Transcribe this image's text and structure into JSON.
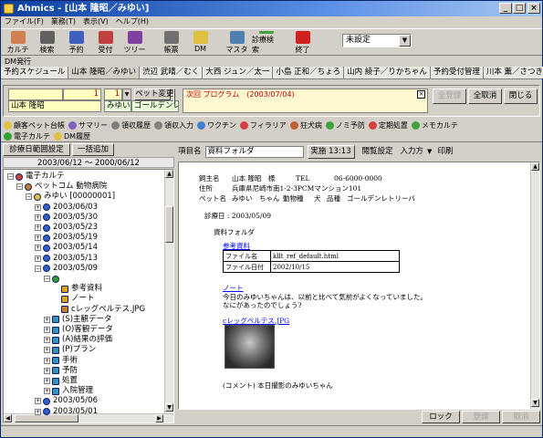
{
  "window": {
    "title": "Ahmics - [山本 隆昭／みゆい]"
  },
  "menu": [
    "ファイル(F)",
    "業務(T)",
    "表示(V)",
    "ヘルプ(H)"
  ],
  "toolbar": {
    "buttons": [
      {
        "label": "カルテ",
        "icon": "skull-icon",
        "color": "#d08050"
      },
      {
        "label": "検索",
        "icon": "binoculars-icon",
        "color": "#606060"
      },
      {
        "label": "予約",
        "icon": "calendar-icon",
        "color": "#4060c0"
      },
      {
        "label": "受付",
        "icon": "checklist-icon",
        "color": "#c04040"
      },
      {
        "label": "ツリー",
        "icon": "tree-icon",
        "color": "#8040a0"
      },
      {
        "label": "帳票",
        "icon": "printer-icon",
        "color": "#707070"
      },
      {
        "label": "DM",
        "icon": "envelope-icon",
        "color": "#e0c040"
      },
      {
        "label": "マスタ",
        "icon": "master-icon",
        "color": "#5080b0"
      },
      {
        "label": "診療検索",
        "icon": "magnifier-icon",
        "color": "#40a040"
      },
      {
        "label": "終了",
        "icon": "stop-icon",
        "color": "#d02020"
      }
    ],
    "select_value": "未設定"
  },
  "dm_label": "DM発行",
  "open_tabs": [
    "予約スケジュール",
    "山本 隆昭／みゆい",
    "渋辺 武晴／むく",
    "大西 ジュン／太一",
    "小島 正和／ちょろ",
    "山内 綾子／りかちゃん",
    "予約受付管理",
    "川本 薫／さつき"
  ],
  "patient": {
    "owner_name": "山本 隆昭",
    "owner_num": "1",
    "pet_name": "みゆい",
    "pet_num": "1",
    "breed": "ゴールデンレトリーバ (♀)",
    "pet_change": "ペット変更",
    "new": "新 規",
    "memo": "次回 プログラム　(2003/07/04)",
    "btn_register": "全登録",
    "btn_cancel_all": "全取消",
    "btn_close": "閉じる"
  },
  "func_tabs_row1": [
    {
      "label": "顧客ペット台帳",
      "color": "#e0c040"
    },
    {
      "label": "サマリー",
      "color": "#8060c0"
    },
    {
      "label": "領収履歴",
      "color": "#808080"
    },
    {
      "label": "領収入力",
      "color": "#808080"
    },
    {
      "label": "ワクチン",
      "color": "#4080d0"
    },
    {
      "label": "フィラリア",
      "color": "#d04040"
    },
    {
      "label": "狂犬病",
      "color": "#c06030"
    },
    {
      "label": "ノミ予防",
      "color": "#40a040"
    },
    {
      "label": "定期処置",
      "color": "#d04040"
    },
    {
      "label": "メモカルテ",
      "color": "#40a040"
    }
  ],
  "func_tabs_row2": [
    {
      "label": "電子カルテ",
      "color": "#30a030"
    },
    {
      "label": "DM履歴",
      "color": "#e0c040"
    }
  ],
  "left": {
    "btn_range": "診療日範囲設定",
    "btn_add": "一括追加",
    "date_range": "2003/06/12 〜 2000/06/12",
    "tree": [
      {
        "label": "電子カルテ",
        "level": 0,
        "type": "root"
      },
      {
        "label": "ペットコム 動物病院",
        "level": 1,
        "type": "hosp"
      },
      {
        "label": "みゆい [00000001]",
        "level": 2,
        "type": "pet"
      },
      {
        "label": "2003/06/03",
        "level": 3,
        "type": "date"
      },
      {
        "label": "2003/05/30",
        "level": 3,
        "type": "date"
      },
      {
        "label": "2003/05/23",
        "level": 3,
        "type": "date"
      },
      {
        "label": "2003/05/19",
        "level": 3,
        "type": "date"
      },
      {
        "label": "2003/05/14",
        "level": 3,
        "type": "date"
      },
      {
        "label": "2003/05/13",
        "level": 3,
        "type": "date"
      },
      {
        "label": "2003/05/09",
        "level": 3,
        "type": "date-open"
      },
      {
        "label": "資料フォルダ",
        "level": 4,
        "type": "selected"
      },
      {
        "label": "参考資料",
        "level": 5,
        "type": "doc"
      },
      {
        "label": "ノート",
        "level": 5,
        "type": "doc"
      },
      {
        "label": "cレッグペルテス.JPG",
        "level": 5,
        "type": "img"
      },
      {
        "label": "(S)主観データ",
        "level": 4,
        "type": "folder"
      },
      {
        "label": "(O)客観データ",
        "level": 4,
        "type": "folder"
      },
      {
        "label": "(A)結果の評価",
        "level": 4,
        "type": "folder"
      },
      {
        "label": "(P)プラン",
        "level": 4,
        "type": "folder"
      },
      {
        "label": "手術",
        "level": 4,
        "type": "folder"
      },
      {
        "label": "予防",
        "level": 4,
        "type": "folder"
      },
      {
        "label": "処置",
        "level": 4,
        "type": "folder"
      },
      {
        "label": "入院管理",
        "level": 4,
        "type": "folder"
      },
      {
        "label": "2003/05/06",
        "level": 3,
        "type": "date"
      },
      {
        "label": "2003/05/01",
        "level": 3,
        "type": "date"
      }
    ]
  },
  "right": {
    "item_label": "項目名",
    "item_value": "資料フォルダ",
    "btn_run": "実施 13:13",
    "btn_view": "閲覧設定",
    "btn_input": "入力方",
    "btn_print": "印刷",
    "doc": {
      "owner_label": "飼主名",
      "owner": "山本 隆昭　様",
      "tel_label": "TEL",
      "tel": "06-6000-0000",
      "addr_label": "住所",
      "addr": "兵庫県尼崎市南1-2-3PCMマンション101",
      "pet_label": "ペット名",
      "pet": "みゆい　ちゃん",
      "species_label": "動物種",
      "species": "犬",
      "breed_label": "品種",
      "breed": "ゴールデンレトリーバ",
      "date": "診療日 : 2003/05/09",
      "folder": "資料フォルダ",
      "ref_link": "参考資料",
      "file_name_label": "ファイル名",
      "file_name": "kllt_ref_default.html",
      "file_date_label": "ファイル日付",
      "file_date": "2002/10/15",
      "note_link": "ノート",
      "note_line1": "今日のみゆいちゃんは、以前と比べて気前がよくなっていました。",
      "note_line2": "なにがあったのでしょう?",
      "img_link": "cレッグペルテス.JPG",
      "comment": "(コメント) 本日撮影のみゆいちゃん"
    },
    "btn_lock": "ロック",
    "btn_save": "登録",
    "btn_cancel": "取消"
  }
}
